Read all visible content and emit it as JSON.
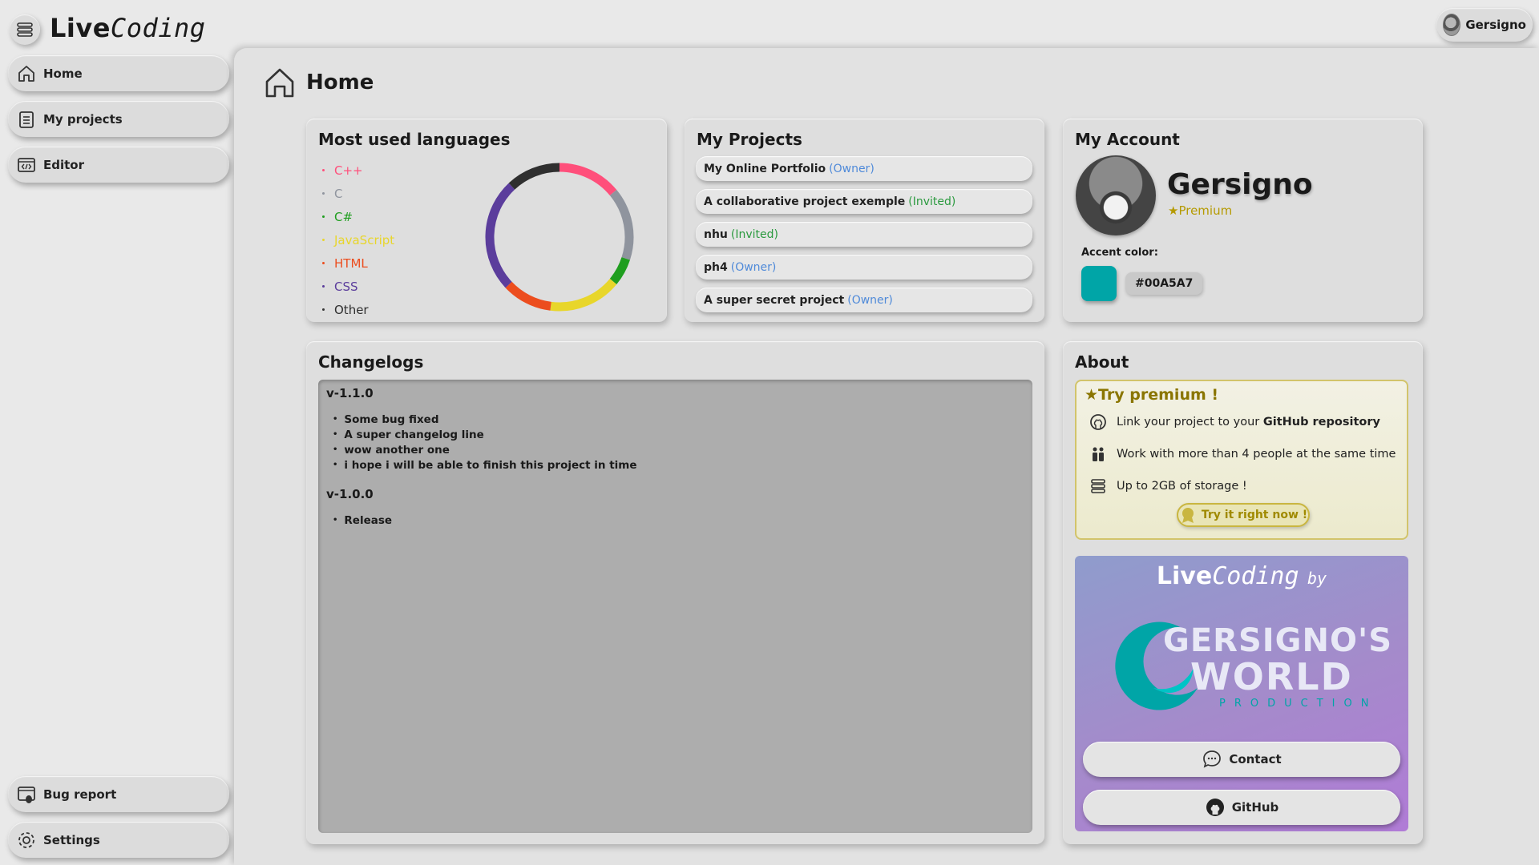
{
  "app": {
    "title_part1": "Live",
    "title_part2": "Coding"
  },
  "user": {
    "name": "Gersigno"
  },
  "sidebar": {
    "items": [
      {
        "label": "Home",
        "icon": "home-icon"
      },
      {
        "label": "My projects",
        "icon": "clipboard-icon"
      },
      {
        "label": "Editor",
        "icon": "code-window-icon"
      }
    ],
    "bottom_items": [
      {
        "label": "Bug report",
        "icon": "bug-icon"
      },
      {
        "label": "Settings",
        "icon": "gear-icon"
      }
    ]
  },
  "page": {
    "title": "Home"
  },
  "languages_card": {
    "title": "Most used languages",
    "items": [
      {
        "label": "C++",
        "color": "#ff4f7b"
      },
      {
        "label": "C",
        "color": "#8f949e"
      },
      {
        "label": "C#",
        "color": "#1f9e1f"
      },
      {
        "label": "JavaScript",
        "color": "#e8d62b"
      },
      {
        "label": "HTML",
        "color": "#ec4d1e"
      },
      {
        "label": "CSS",
        "color": "#5b3d9c"
      },
      {
        "label": "Other",
        "color": "#2f2f2f"
      }
    ],
    "chart_data": {
      "type": "pie",
      "donut": true,
      "categories": [
        "C++",
        "C",
        "C#",
        "JavaScript",
        "HTML",
        "CSS",
        "Other"
      ],
      "values": [
        14,
        16,
        6,
        16,
        11,
        25,
        12
      ]
    }
  },
  "projects_card": {
    "title": "My Projects",
    "items": [
      {
        "name": "My Online Portfolio",
        "role": "(Owner)",
        "role_color": "#4f8ad9"
      },
      {
        "name": "A collaborative project exemple",
        "role": "(Invited)",
        "role_color": "#2b9a3f"
      },
      {
        "name": "nhu",
        "role": "(Invited)",
        "role_color": "#2b9a3f"
      },
      {
        "name": "ph4",
        "role": "(Owner)",
        "role_color": "#4f8ad9"
      },
      {
        "name": "A super secret project",
        "role": "(Owner)",
        "role_color": "#4f8ad9"
      }
    ]
  },
  "account_card": {
    "title": "My Account",
    "name": "Gersigno",
    "tier": "★Premium",
    "accent_label": "Accent color:",
    "accent_value": "#00A5A7"
  },
  "changelog_card": {
    "title": "Changelogs",
    "versions": [
      {
        "version": "v-1.1.0",
        "lines": [
          "Some bug fixed",
          "A super changelog line",
          "wow another one",
          "i hope i will be able to finish this project in time"
        ]
      },
      {
        "version": "v-1.0.0",
        "lines": [
          "Release"
        ]
      }
    ]
  },
  "about_card": {
    "title": "About",
    "premium_title": "★Try premium !",
    "perks": [
      {
        "text_before": "Link your project to your ",
        "text_bold": "GitHub repository",
        "icon": "github-icon"
      },
      {
        "text_before": "Work with more than 4 people at the same time",
        "text_bold": "",
        "icon": "people-icon"
      },
      {
        "text_before": "Up to 2GB of storage !",
        "text_bold": "",
        "icon": "storage-icon"
      }
    ],
    "try_button": "Try it right now !",
    "promo": {
      "head_part1": "Live",
      "head_part2": "Coding",
      "head_by": "by",
      "logo_line1": "GERSIGNO'S",
      "logo_line2": "WORLD",
      "logo_line3": "PRODUCTION"
    },
    "contact_button": "Contact",
    "github_button": "GitHub"
  }
}
